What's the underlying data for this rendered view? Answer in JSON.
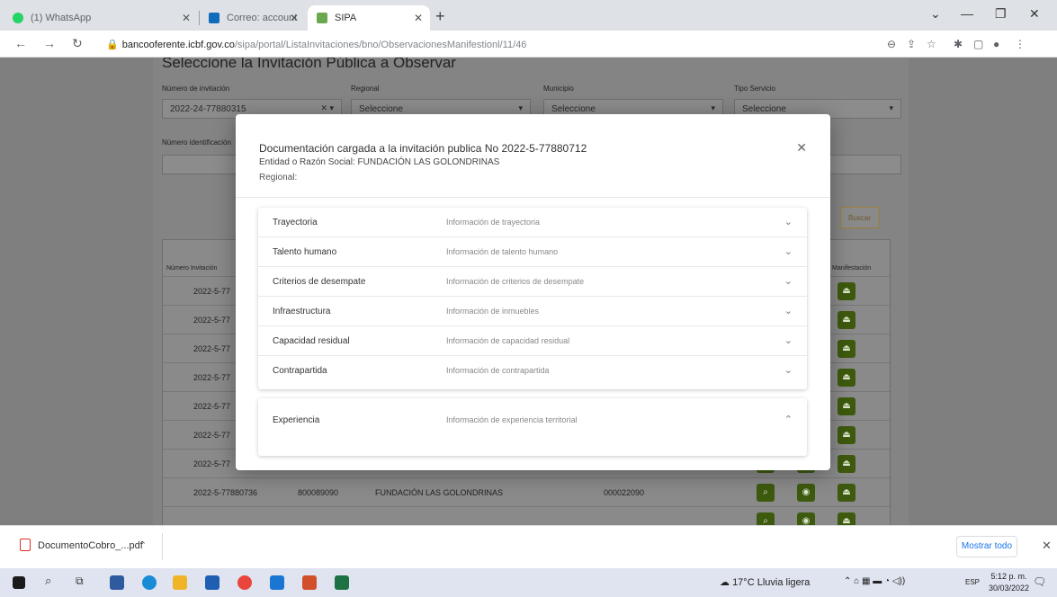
{
  "browser": {
    "tabs": [
      {
        "label": "(1) WhatsApp",
        "active": false
      },
      {
        "label": "Correo: accounting@gardenfa",
        "active": false
      },
      {
        "label": "SIPA",
        "active": true
      }
    ],
    "url_domain": "bancooferente.icbf.gov.co",
    "url_path": "/sipa/portal/ListaInvitaciones/bno/ObservacionesManifestionl/11/46"
  },
  "page": {
    "title": "Seleccione la Invitación Pública a Observar",
    "filters": {
      "numero_label": "Número de invitación",
      "numero_value": "2022-24-77880315",
      "regional_label": "Regional",
      "regional_value": "Seleccione",
      "municipio_label": "Municipio",
      "municipio_value": "Seleccione",
      "tipo_label": "Tipo Servicio",
      "tipo_value": "Seleccione",
      "ident_label": "Número identificación"
    },
    "buttons": {
      "buscar": "Buscar"
    },
    "table": {
      "col_numero": "Número Invitación",
      "col_acciones": "Manifestación",
      "rows": [
        {
          "numero": "2022-5-77"
        },
        {
          "numero": "2022-5-77"
        },
        {
          "numero": "2022-5-77"
        },
        {
          "numero": "2022-5-77"
        },
        {
          "numero": "2022-5-77"
        },
        {
          "numero": "2022-5-77"
        },
        {
          "numero": "2022-5-77"
        },
        {
          "numero": "2022-5-77880736",
          "nit": "800089090",
          "entidad": "FUNDACIÓN LAS GOLONDRINAS",
          "codigo": "000022090"
        }
      ]
    }
  },
  "modal": {
    "title": "Documentación cargada a la invitación publica No 2022-5-77880712",
    "entity": "Entidad o Razón Social: FUNDACIÓN LAS GOLONDRINAS",
    "regional": "Regional:",
    "sections": [
      {
        "label": "Trayectoria",
        "desc": "Información de trayectoria",
        "expanded": false
      },
      {
        "label": "Talento humano",
        "desc": "Información de talento humano",
        "expanded": false
      },
      {
        "label": "Criterios de desempate",
        "desc": "Información de criterios de desempate",
        "expanded": false
      },
      {
        "label": "Infraestructura",
        "desc": "Información de inmuebles",
        "expanded": false
      },
      {
        "label": "Capacidad residual",
        "desc": "Información de capacidad residual",
        "expanded": false
      },
      {
        "label": "Contrapartida",
        "desc": "Información de contrapartida",
        "expanded": false
      }
    ],
    "expanded_section": {
      "label": "Experiencia",
      "desc": "Información de experiencia territorial",
      "expanded": true
    }
  },
  "downloads": {
    "file": "DocumentoCobro_...pdf",
    "show_all": "Mostrar todo"
  },
  "taskbar": {
    "weather": "17°C  Lluvia ligera",
    "lang": "ESP",
    "time": "5:12 p. m.",
    "date": "30/03/2022"
  }
}
